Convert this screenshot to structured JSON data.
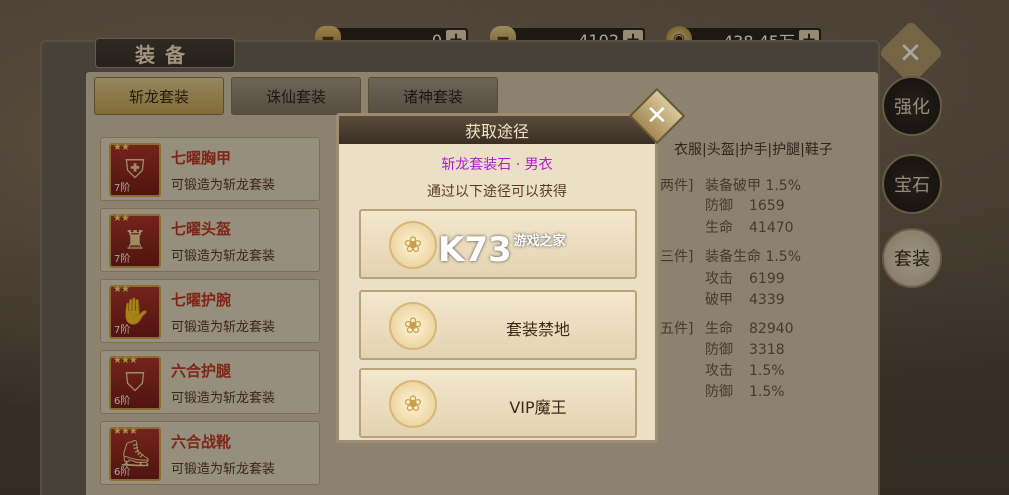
{
  "currency": [
    {
      "icon": "gold-ingot-icon",
      "value": "0"
    },
    {
      "icon": "silver-ingot-icon",
      "value": "4102"
    },
    {
      "icon": "coin-icon",
      "value": "438.45万"
    }
  ],
  "panel": {
    "title": "装备",
    "tabs": [
      "斩龙套装",
      "诛仙套装",
      "诸神套装"
    ]
  },
  "items": [
    {
      "name": "七曜胸甲",
      "sub": "可锻造为斩龙套装",
      "grade": "7阶"
    },
    {
      "name": "七曜头盔",
      "sub": "可锻造为斩龙套装",
      "grade": "7阶"
    },
    {
      "name": "七曜护腕",
      "sub": "可锻造为斩龙套装",
      "grade": "7阶"
    },
    {
      "name": "六合护腿",
      "sub": "可锻造为斩龙套装",
      "grade": "6阶"
    },
    {
      "name": "六合战靴",
      "sub": "可锻造为斩龙套装",
      "grade": "6阶"
    }
  ],
  "stats": {
    "header": "衣服|头盔|护手|护腿|鞋子",
    "groups": [
      {
        "tag": "两件]",
        "lines": [
          [
            "装备破甲",
            "1.5%"
          ],
          [
            "防御",
            "1659"
          ],
          [
            "生命",
            "41470"
          ]
        ]
      },
      {
        "tag": "三件]",
        "lines": [
          [
            "装备生命",
            "1.5%"
          ],
          [
            "攻击",
            "6199"
          ],
          [
            "破甲",
            "4339"
          ]
        ]
      },
      {
        "tag": "五件]",
        "lines": [
          [
            "生命",
            "82940"
          ],
          [
            "防御",
            "3318"
          ],
          [
            "攻击",
            "1.5%"
          ],
          [
            "防御",
            "1.5%"
          ]
        ]
      }
    ]
  },
  "side_buttons": [
    "强化",
    "宝石",
    "套装"
  ],
  "dialog": {
    "header": "获取途径",
    "item_name": "斩龙套装石 · 男衣",
    "desc": "通过以下途径可以获得",
    "routes": [
      "",
      "套装禁地",
      "VIP魔王"
    ]
  },
  "watermark": {
    "main": "K73",
    "sub": "游戏之家"
  }
}
